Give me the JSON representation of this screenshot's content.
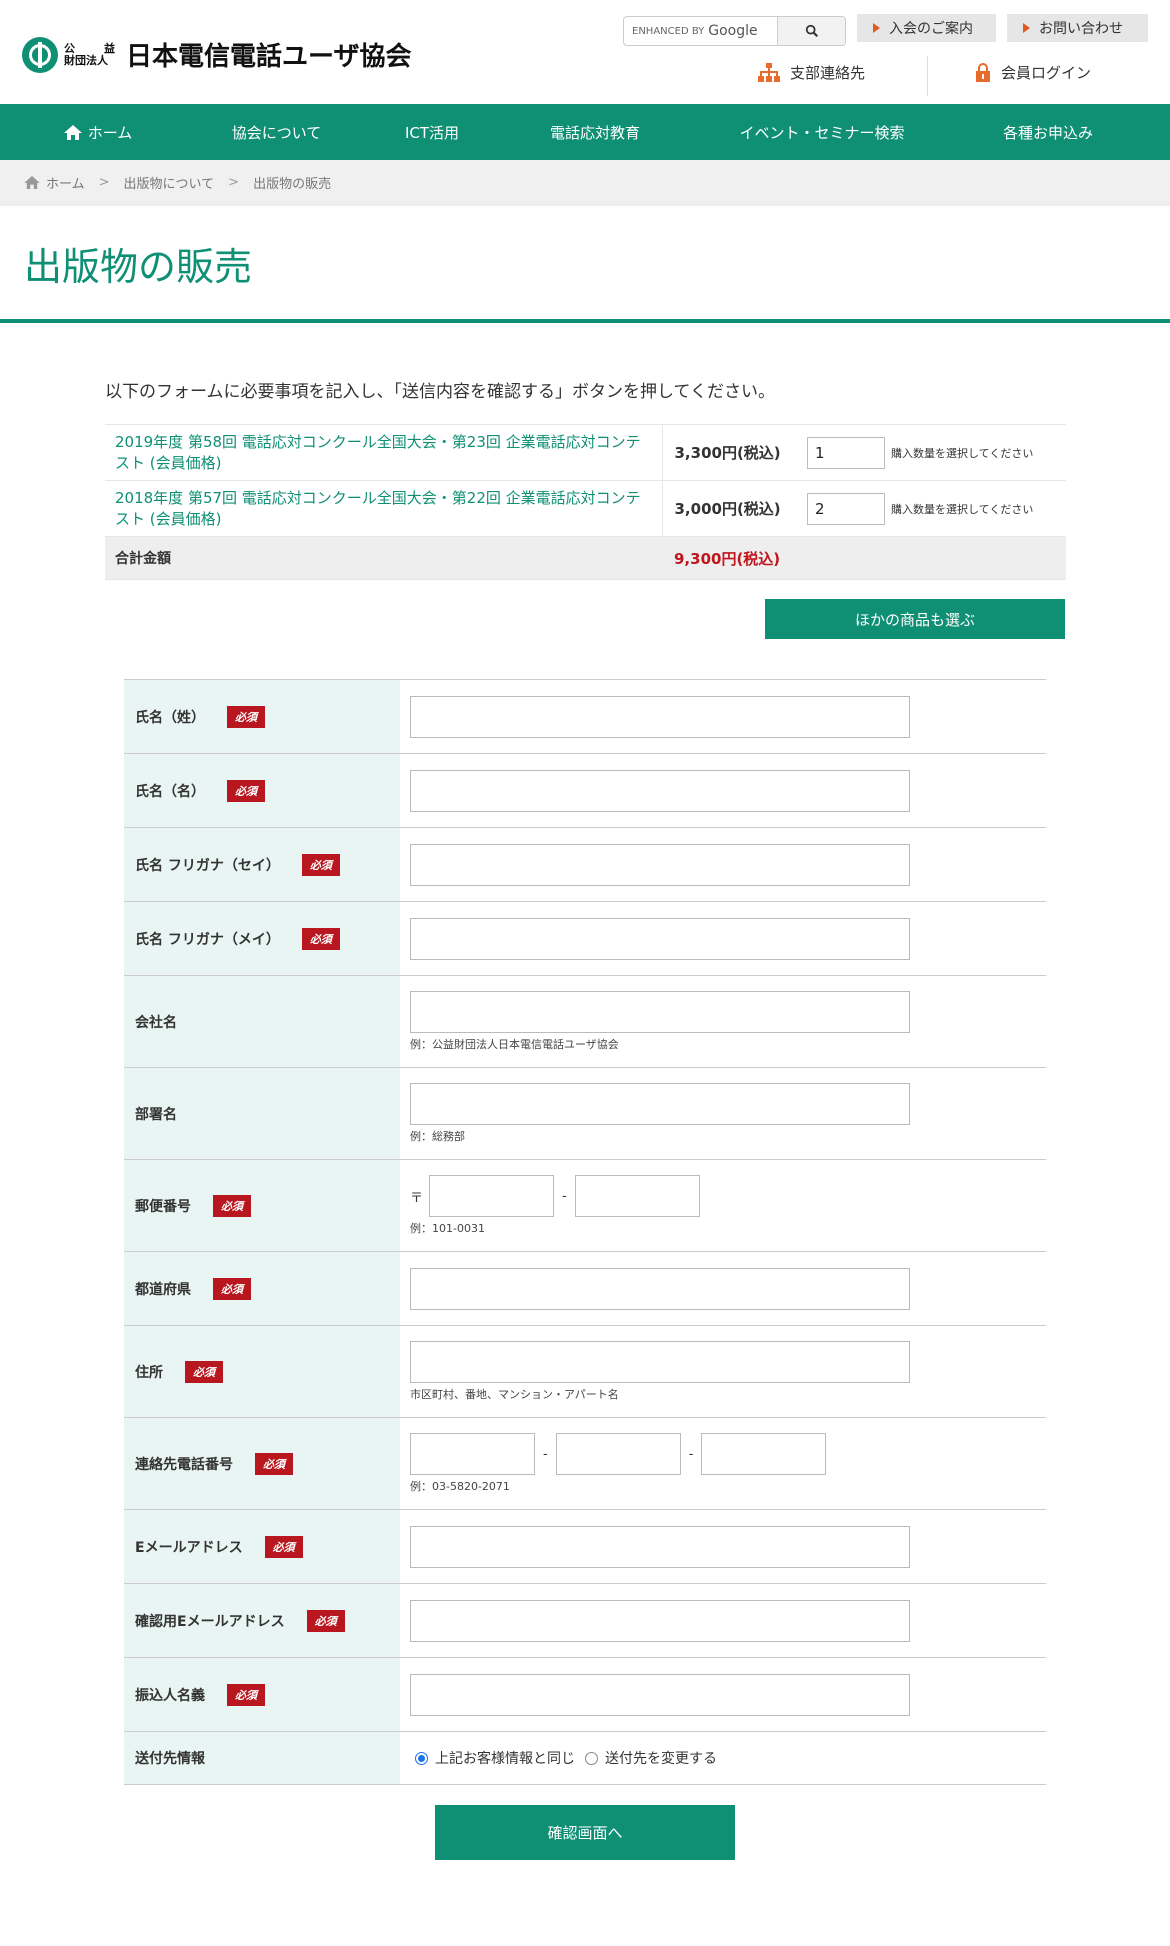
{
  "header": {
    "logo_small_top": "公　益",
    "logo_small_bottom": "財団法人",
    "logo_text": "日本電信電話ユーザ協会",
    "search_brand": "ENHANCED BY",
    "search_google": "Google",
    "join_label": "入会のご案内",
    "contact_label": "お問い合わせ",
    "branch_label": "支部連絡先",
    "login_label": "会員ログイン"
  },
  "nav": {
    "items": [
      "ホーム",
      "協会について",
      "ICT活用",
      "電話応対教育",
      "イベント・セミナー検索",
      "各種お申込み"
    ]
  },
  "breadcrumb": {
    "items": [
      "ホーム",
      "出版物について",
      "出版物の販売"
    ]
  },
  "page": {
    "title": "出版物の販売",
    "intro": "以下のフォームに必要事項を記入し、「送信内容を確認する」ボタンを押してください。"
  },
  "products": [
    {
      "name": "2019年度 第58回 電話応対コンクール全国大会・第23回 企業電話応対コンテスト (会員価格)",
      "price": "3,300円(税込)",
      "qty": "1",
      "note": "購入数量を選択してください"
    },
    {
      "name": "2018年度 第57回 電話応対コンクール全国大会・第22回 企業電話応対コンテスト (会員価格)",
      "price": "3,000円(税込)",
      "qty": "2",
      "note": "購入数量を選択してください"
    }
  ],
  "total": {
    "label": "合計金額",
    "value": "9,300円(税込)"
  },
  "other_button": "ほかの商品も選ぶ",
  "required_label": "必須",
  "form": {
    "last_name": "氏名（姓）",
    "first_name": "氏名（名）",
    "kana_sei": "氏名 フリガナ（セイ）",
    "kana_mei": "氏名 フリガナ（メイ）",
    "company": "会社名",
    "company_hint": "例：公益財団法人日本電信電話ユーザ協会",
    "department": "部署名",
    "department_hint": "例：総務部",
    "zip": "郵便番号",
    "zip_mark": "〒",
    "zip_hint": "例：101-0031",
    "prefecture": "都道府県",
    "address": "住所",
    "address_hint": "市区町村、番地、マンション・アパート名",
    "tel": "連絡先電話番号",
    "tel_hint": "例：03-5820-2071",
    "email": "Eメールアドレス",
    "email_confirm": "確認用Eメールアドレス",
    "payer": "振込人名義",
    "shipping": "送付先情報",
    "shipping_same": "上記お客様情報と同じ",
    "shipping_change": "送付先を変更する",
    "dash": "-"
  },
  "confirm_button": "確認画面へ",
  "colors": {
    "brand": "#0f8f74",
    "required": "#b8171f",
    "label_bg": "#e9f5f3"
  }
}
